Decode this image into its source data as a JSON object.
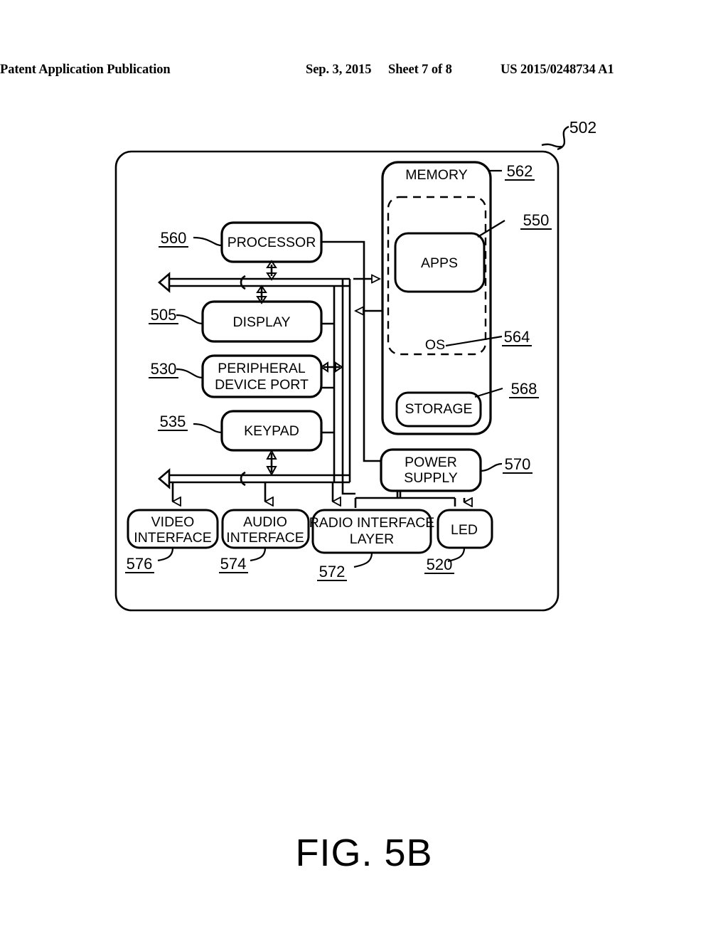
{
  "header": {
    "publication": "Patent Application Publication",
    "date": "Sep. 3, 2015",
    "sheet": "Sheet 7 of 8",
    "number": "US 2015/0248734 A1"
  },
  "figure": {
    "caption": "FIG. 5B",
    "device_ref": "502"
  },
  "blocks": {
    "processor": {
      "label": "PROCESSOR",
      "ref": "560"
    },
    "display": {
      "label": "DISPLAY",
      "ref": "505"
    },
    "peripheral_port": {
      "label_line1": "PERIPHERAL",
      "label_line2": "DEVICE PORT",
      "ref": "530"
    },
    "keypad": {
      "label": "KEYPAD",
      "ref": "535"
    },
    "memory": {
      "label": "MEMORY",
      "ref": "562"
    },
    "apps": {
      "label": "APPS",
      "ref": "550"
    },
    "os": {
      "label": "OS",
      "ref": "564"
    },
    "storage": {
      "label": "STORAGE",
      "ref": "568"
    },
    "power_supply": {
      "label_line1": "POWER",
      "label_line2": "SUPPLY",
      "ref": "570"
    },
    "video_interface": {
      "label_line1": "VIDEO",
      "label_line2": "INTERFACE",
      "ref": "576"
    },
    "audio_interface": {
      "label_line1": "AUDIO",
      "label_line2": "INTERFACE",
      "ref": "574"
    },
    "radio_interface": {
      "label_line1": "RADIO INTERFACE",
      "label_line2": "LAYER",
      "ref": "572"
    },
    "led": {
      "label": "LED",
      "ref": "520"
    }
  },
  "style": {
    "line_color": "#000000",
    "background": "#ffffff"
  }
}
